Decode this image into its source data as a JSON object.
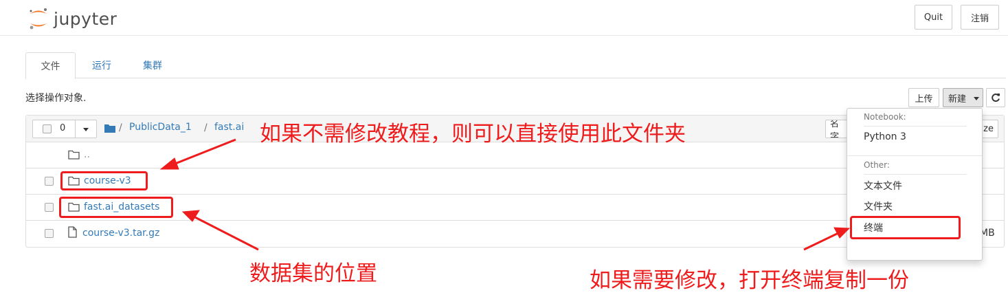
{
  "header": {
    "logo_text": "jupyter",
    "quit_label": "Quit",
    "logout_label": "注销"
  },
  "tabs": [
    {
      "label": "文件",
      "active": true
    },
    {
      "label": "运行",
      "active": false
    },
    {
      "label": "集群",
      "active": false
    }
  ],
  "toolbar": {
    "select_hint": "选择操作对象.",
    "upload_label": "上传",
    "new_label": "新建",
    "refresh_icon": "refresh-icon"
  },
  "file_panel": {
    "selected_count": "0",
    "breadcrumb": [
      {
        "label": "PublicData_1"
      },
      {
        "label": "fast.ai"
      }
    ],
    "breadcrumb_sep": "/",
    "sort_name_partial": "名字",
    "sort_size_partial": "ze",
    "rows": [
      {
        "name": "..",
        "type": "folder",
        "checkbox": false
      },
      {
        "name": "course-v3",
        "type": "folder",
        "checkbox": true
      },
      {
        "name": "fast.ai_datasets",
        "type": "folder",
        "checkbox": true
      },
      {
        "name": "course-v3.tar.gz",
        "type": "file",
        "checkbox": true,
        "size_partial": "MB"
      }
    ]
  },
  "new_dropdown": {
    "notebook_header": "Notebook:",
    "python_item": "Python 3",
    "other_header": "Other:",
    "text_file_item": "文本文件",
    "folder_item": "文件夹",
    "terminal_item": "终端"
  },
  "annotations": {
    "note_top": "如果不需修改教程，则可以直接使用此文件夹",
    "note_datasets": "数据集的位置",
    "note_terminal": "如果需要修改，打开终端复制一份",
    "color": "#ee1c1c"
  }
}
